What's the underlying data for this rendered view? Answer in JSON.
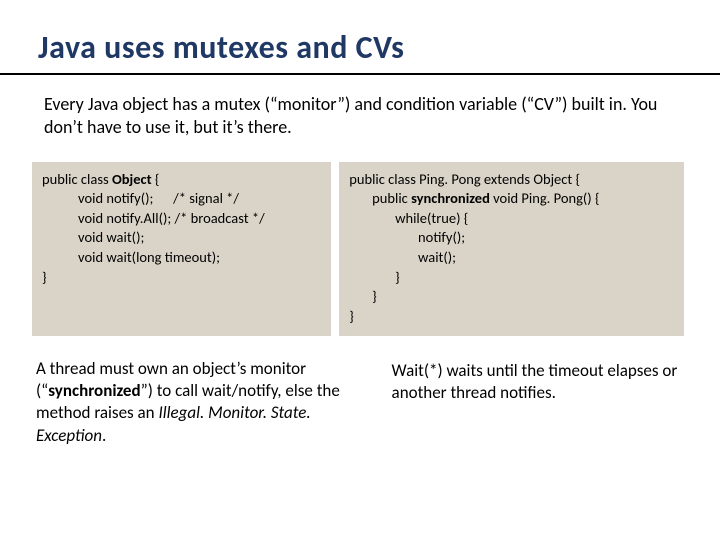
{
  "title": "Java uses mutexes and CVs",
  "intro": "Every Java object has a mutex (“monitor”) and condition variable (“CV”) built in.  You don’t have to use it, but it’s there.",
  "left_code": {
    "l1a": "public class ",
    "l1b": "Object",
    "l1c": " {",
    "l2": "           void notify();      /* signal */",
    "l3": "           void notify.All(); /* broadcast */",
    "l4": "           void wait();",
    "l5": "           void wait(long timeout);",
    "l6": "}"
  },
  "right_code": {
    "l1": "public class Ping. Pong extends Object {",
    "l2a": "       public ",
    "l2b": "synchronized",
    "l2c": " void Ping. Pong() {",
    "l3": "              while(true) {",
    "l4": "                     notify();",
    "l5": "                     wait();",
    "l6": "              }",
    "l7": "       }",
    "l8": "}"
  },
  "footer_left": {
    "t1": "A thread must own an object’s monitor (“",
    "t2": "synchronized",
    "t3": "”) to call wait/notify, else the method raises an ",
    "t4": "Illegal. Monitor. State. Exception",
    "t5": "."
  },
  "footer_right": "Wait(*) waits until the timeout elapses or another thread notifies."
}
